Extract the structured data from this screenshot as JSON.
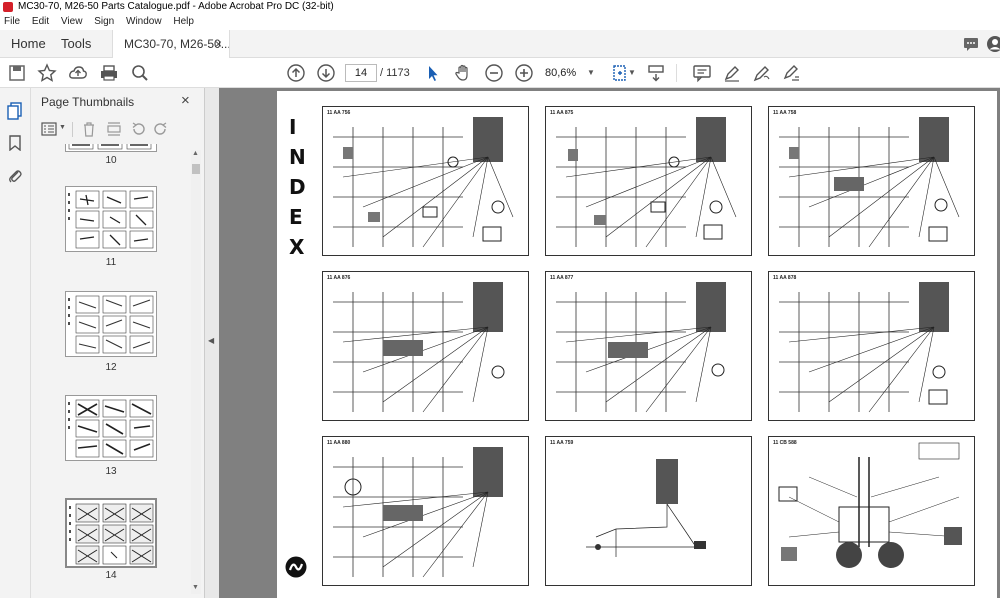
{
  "window": {
    "title": "MC30-70, M26-50 Parts Catalogue.pdf - Adobe Acrobat Pro DC (32-bit)"
  },
  "menu": [
    "File",
    "Edit",
    "View",
    "Sign",
    "Window",
    "Help"
  ],
  "tabs": {
    "home": "Home",
    "tools": "Tools",
    "document": "MC30-70, M26-50...",
    "close": "×"
  },
  "toolbar": {
    "page_current": "14",
    "page_total": "/ 1173",
    "zoom": "80,6%"
  },
  "panel": {
    "title": "Page Thumbnails",
    "close": "×",
    "thumbnails": [
      {
        "label": "10"
      },
      {
        "label": "11"
      },
      {
        "label": "12"
      },
      {
        "label": "13"
      },
      {
        "label": "14"
      }
    ]
  },
  "page": {
    "index_letters": [
      "I",
      "N",
      "D",
      "E",
      "X"
    ],
    "panels": [
      {
        "code": "11 AA 756"
      },
      {
        "code": "11 AA 875"
      },
      {
        "code": "11 AA 758"
      },
      {
        "code": "11 AA 876"
      },
      {
        "code": "11 AA 877"
      },
      {
        "code": "11 AA 878"
      },
      {
        "code": "11 AA 880"
      },
      {
        "code": "11 AA 759"
      },
      {
        "code": "11 CB 588"
      }
    ]
  }
}
